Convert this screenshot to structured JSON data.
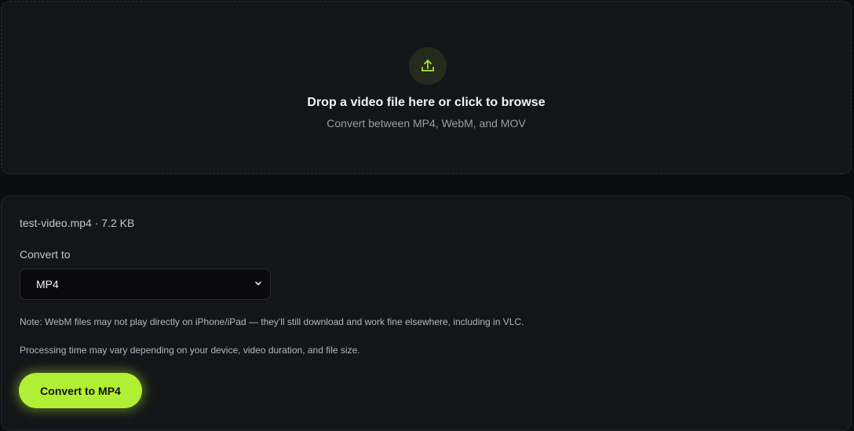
{
  "dropzone": {
    "icon": "upload-icon",
    "title": "Drop a video file here or click to browse",
    "subtitle": "Convert between MP4, WebM, and MOV"
  },
  "file": {
    "info": "test-video.mp4 · 7.2 KB"
  },
  "convert": {
    "label": "Convert to",
    "selected": "MP4",
    "dropdown_icon": "chevron-down-icon"
  },
  "notes": {
    "webm": "Note: WebM files may not play directly on iPhone/iPad — they'll still download and work fine elsewhere, including in VLC.",
    "processing": "Processing time may vary depending on your device, video duration, and file size."
  },
  "action": {
    "button_label": "Convert to MP4"
  },
  "colors": {
    "accent": "#b1ef34",
    "background": "#0c0d0f",
    "panel": "#141518"
  }
}
